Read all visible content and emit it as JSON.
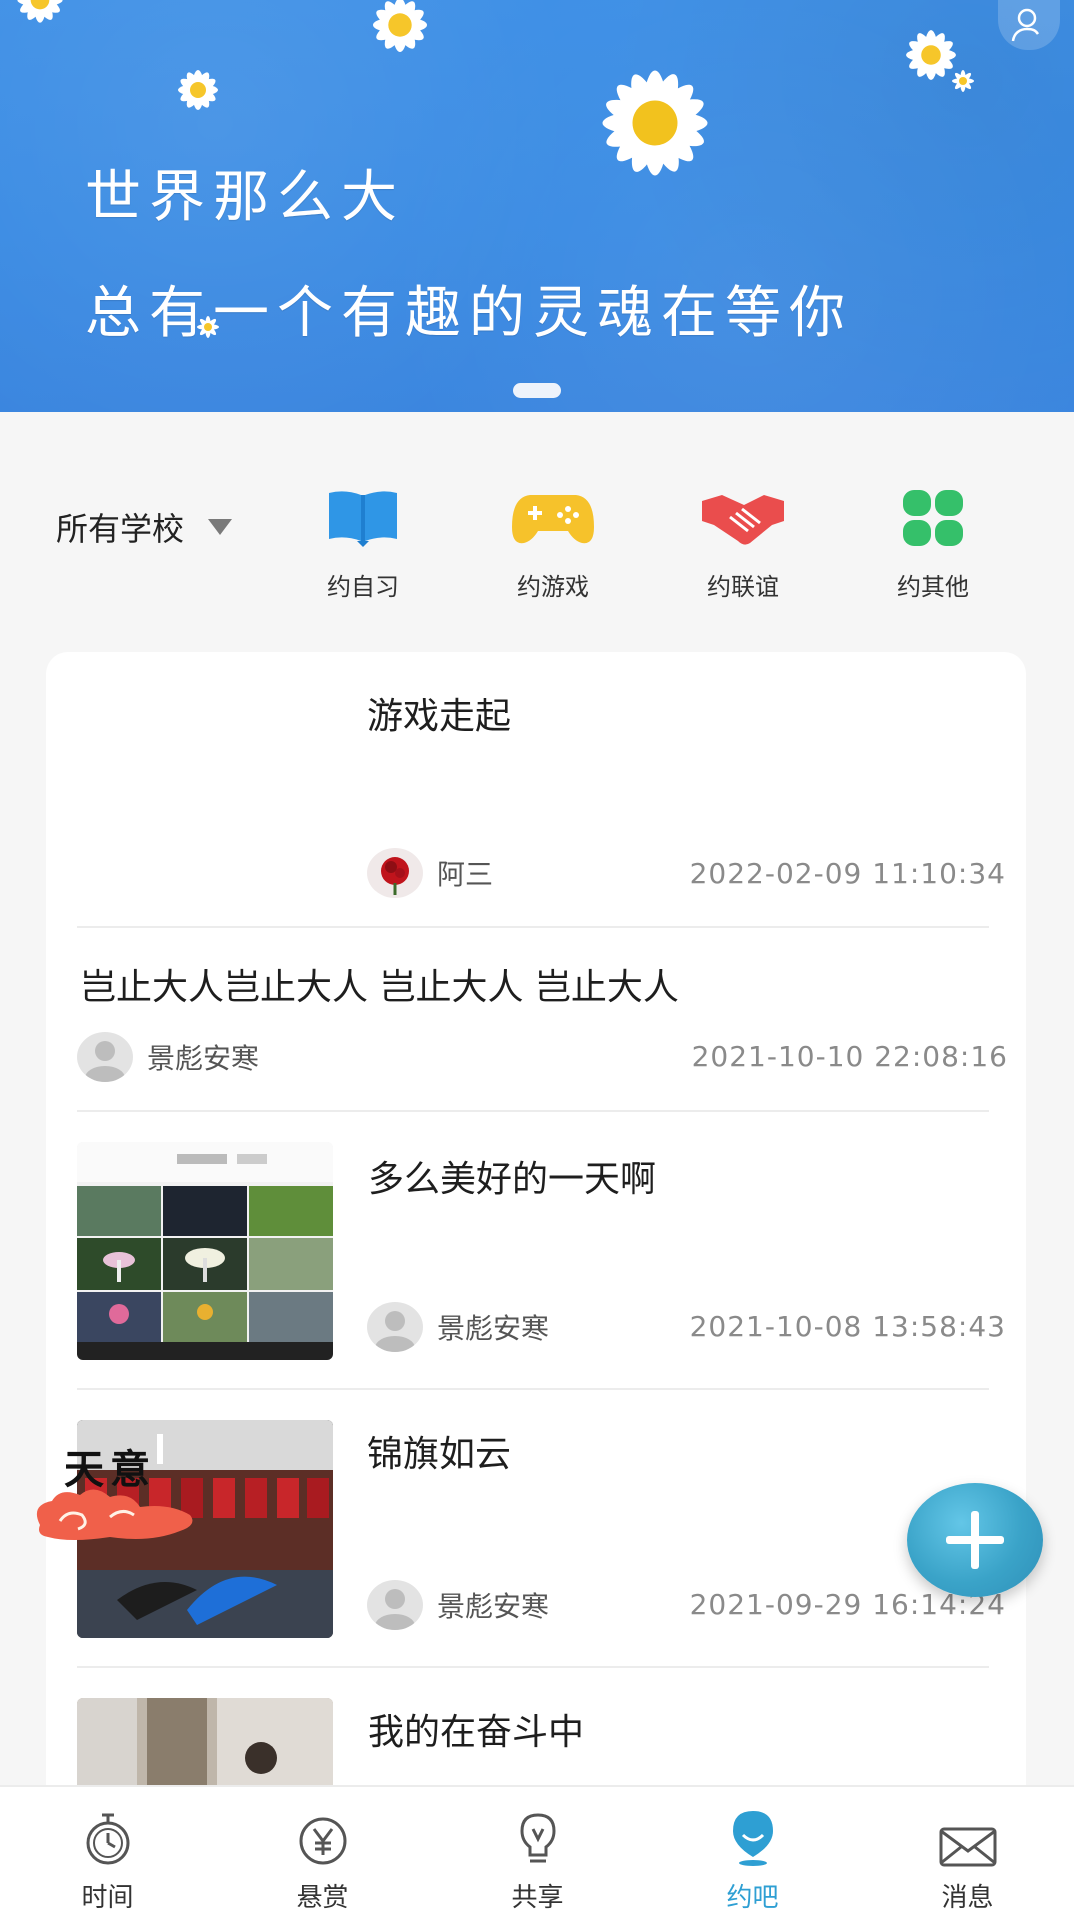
{
  "banner": {
    "line1": "世界那么大",
    "line2": "总有一个有趣的灵魂在等你"
  },
  "filter": {
    "school_label": "所有学校"
  },
  "categories": [
    {
      "label": "约自习",
      "icon": "book-icon",
      "color": "#2f96e6"
    },
    {
      "label": "约游戏",
      "icon": "gamepad-icon",
      "color": "#f6c22b"
    },
    {
      "label": "约联谊",
      "icon": "handshake-icon",
      "color": "#ea4d4d"
    },
    {
      "label": "约其他",
      "icon": "clover-icon",
      "color": "#35c06a"
    }
  ],
  "posts": [
    {
      "title": "游戏走起",
      "author": "阿三",
      "date": "2022-02-09 11:10:34"
    },
    {
      "title": "岂止大人岂止大人 岂止大人 岂止大人",
      "author": "景彪安寒",
      "date": "2021-10-10 22:08:16"
    },
    {
      "title": "多么美好的一天啊",
      "author": "景彪安寒",
      "date": "2021-10-08 13:58:43"
    },
    {
      "title": "锦旗如云",
      "author": "景彪安寒",
      "date": "2021-09-29 16:14:24",
      "overlay": "天意"
    },
    {
      "title": "我的在奋斗中"
    }
  ],
  "tabs": [
    {
      "label": "时间",
      "icon": "stopwatch-icon"
    },
    {
      "label": "悬赏",
      "icon": "yuan-coin-icon"
    },
    {
      "label": "共享",
      "icon": "lightbulb-icon"
    },
    {
      "label": "约吧",
      "icon": "location-pin-icon",
      "active": true
    },
    {
      "label": "消息",
      "icon": "envelope-icon"
    }
  ],
  "colors": {
    "accent": "#2e9fd3",
    "banner": "#3a8be3"
  }
}
